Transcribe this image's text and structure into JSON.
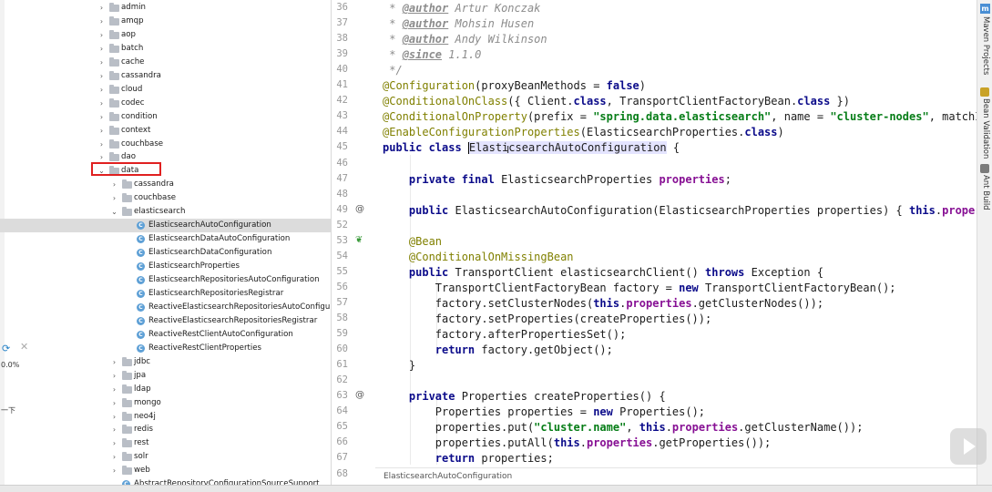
{
  "tree": {
    "items": [
      {
        "label": "admin",
        "type": "folder",
        "depth": 0,
        "expanded": false
      },
      {
        "label": "amqp",
        "type": "folder",
        "depth": 0,
        "expanded": false
      },
      {
        "label": "aop",
        "type": "folder",
        "depth": 0,
        "expanded": false
      },
      {
        "label": "batch",
        "type": "folder",
        "depth": 0,
        "expanded": false
      },
      {
        "label": "cache",
        "type": "folder",
        "depth": 0,
        "expanded": false
      },
      {
        "label": "cassandra",
        "type": "folder",
        "depth": 0,
        "expanded": false
      },
      {
        "label": "cloud",
        "type": "folder",
        "depth": 0,
        "expanded": false
      },
      {
        "label": "codec",
        "type": "folder",
        "depth": 0,
        "expanded": false
      },
      {
        "label": "condition",
        "type": "folder",
        "depth": 0,
        "expanded": false
      },
      {
        "label": "context",
        "type": "folder",
        "depth": 0,
        "expanded": false
      },
      {
        "label": "couchbase",
        "type": "folder",
        "depth": 0,
        "expanded": false
      },
      {
        "label": "dao",
        "type": "folder",
        "depth": 0,
        "expanded": false
      },
      {
        "label": "data",
        "type": "folder",
        "depth": 0,
        "expanded": true
      },
      {
        "label": "cassandra",
        "type": "folder",
        "depth": 1,
        "expanded": false
      },
      {
        "label": "couchbase",
        "type": "folder",
        "depth": 1,
        "expanded": false
      },
      {
        "label": "elasticsearch",
        "type": "folder",
        "depth": 1,
        "expanded": true
      },
      {
        "label": "ElasticsearchAutoConfiguration",
        "type": "class",
        "depth": 2,
        "selected": true
      },
      {
        "label": "ElasticsearchDataAutoConfiguration",
        "type": "class",
        "depth": 2
      },
      {
        "label": "ElasticsearchDataConfiguration",
        "type": "class",
        "depth": 2
      },
      {
        "label": "ElasticsearchProperties",
        "type": "class",
        "depth": 2
      },
      {
        "label": "ElasticsearchRepositoriesAutoConfiguration",
        "type": "class",
        "depth": 2
      },
      {
        "label": "ElasticsearchRepositoriesRegistrar",
        "type": "class",
        "depth": 2
      },
      {
        "label": "ReactiveElasticsearchRepositoriesAutoConfigurat",
        "type": "class",
        "depth": 2
      },
      {
        "label": "ReactiveElasticsearchRepositoriesRegistrar",
        "type": "class",
        "depth": 2
      },
      {
        "label": "ReactiveRestClientAutoConfiguration",
        "type": "class",
        "depth": 2
      },
      {
        "label": "ReactiveRestClientProperties",
        "type": "class",
        "depth": 2
      },
      {
        "label": "jdbc",
        "type": "folder",
        "depth": 1,
        "expanded": false
      },
      {
        "label": "jpa",
        "type": "folder",
        "depth": 1,
        "expanded": false
      },
      {
        "label": "ldap",
        "type": "folder",
        "depth": 1,
        "expanded": false
      },
      {
        "label": "mongo",
        "type": "folder",
        "depth": 1,
        "expanded": false
      },
      {
        "label": "neo4j",
        "type": "folder",
        "depth": 1,
        "expanded": false
      },
      {
        "label": "redis",
        "type": "folder",
        "depth": 1,
        "expanded": false
      },
      {
        "label": "rest",
        "type": "folder",
        "depth": 1,
        "expanded": false
      },
      {
        "label": "solr",
        "type": "folder",
        "depth": 1,
        "expanded": false
      },
      {
        "label": "web",
        "type": "folder",
        "depth": 1,
        "expanded": false
      },
      {
        "label": "AbstractRepositoryConfigurationSourceSupport",
        "type": "class",
        "depth": 1
      }
    ]
  },
  "overlay": {
    "percent": "0.0%",
    "chinese": "一下"
  },
  "editor": {
    "line_numbers": [
      "36",
      "37",
      "38",
      "39",
      "40",
      "41",
      "42",
      "43",
      "44",
      "45",
      "46",
      "47",
      "48",
      "49",
      "52",
      "53",
      "54",
      "55",
      "56",
      "57",
      "58",
      "59",
      "60",
      "61",
      "62",
      "63",
      "64",
      "65",
      "66",
      "67",
      "68"
    ],
    "lines": [
      [
        {
          "t": " * ",
          "c": "c"
        },
        {
          "t": "@author",
          "c": "cd"
        },
        {
          "t": " Artur Konczak",
          "c": "c"
        }
      ],
      [
        {
          "t": " * ",
          "c": "c"
        },
        {
          "t": "@author",
          "c": "cd"
        },
        {
          "t": " Mohsin Husen",
          "c": "c"
        }
      ],
      [
        {
          "t": " * ",
          "c": "c"
        },
        {
          "t": "@author",
          "c": "cd"
        },
        {
          "t": " Andy Wilkinson",
          "c": "c"
        }
      ],
      [
        {
          "t": " * ",
          "c": "c"
        },
        {
          "t": "@since",
          "c": "cd"
        },
        {
          "t": " 1.1.0",
          "c": "c"
        }
      ],
      [
        {
          "t": " */",
          "c": "c"
        }
      ],
      [
        {
          "t": "@Configuration",
          "c": "a"
        },
        {
          "t": "(proxyBeanMethods = ",
          "c": ""
        },
        {
          "t": "false",
          "c": "k"
        },
        {
          "t": ")",
          "c": ""
        }
      ],
      [
        {
          "t": "@ConditionalOnClass",
          "c": "a"
        },
        {
          "t": "({ Client.",
          "c": ""
        },
        {
          "t": "class",
          "c": "k"
        },
        {
          "t": ", TransportClientFactoryBean.",
          "c": ""
        },
        {
          "t": "class",
          "c": "k"
        },
        {
          "t": " })",
          "c": ""
        }
      ],
      [
        {
          "t": "@ConditionalOnProperty",
          "c": "a"
        },
        {
          "t": "(prefix = ",
          "c": ""
        },
        {
          "t": "\"spring.data.elasticsearch\"",
          "c": "s"
        },
        {
          "t": ", name = ",
          "c": ""
        },
        {
          "t": "\"cluster-nodes\"",
          "c": "s"
        },
        {
          "t": ", matchI",
          "c": ""
        }
      ],
      [
        {
          "t": "@EnableConfigurationProperties",
          "c": "a"
        },
        {
          "t": "(ElasticsearchProperties.",
          "c": ""
        },
        {
          "t": "class",
          "c": "k"
        },
        {
          "t": ")",
          "c": ""
        }
      ],
      [
        {
          "t": "public class ",
          "c": "k"
        },
        {
          "t": "|",
          "c": "caret"
        },
        {
          "t": "ElasticsearchAutoConfiguration",
          "c": "hl"
        },
        {
          "t": " {",
          "c": ""
        }
      ],
      [],
      [
        {
          "t": "    ",
          "c": ""
        },
        {
          "t": "private final ",
          "c": "k"
        },
        {
          "t": "ElasticsearchProperties ",
          "c": ""
        },
        {
          "t": "properties",
          "c": "f"
        },
        {
          "t": ";",
          "c": ""
        }
      ],
      [],
      [
        {
          "t": "    ",
          "c": ""
        },
        {
          "t": "public ",
          "c": "k"
        },
        {
          "t": "ElasticsearchAutoConfiguration(ElasticsearchProperties properties) { ",
          "c": ""
        },
        {
          "t": "this",
          "c": "k"
        },
        {
          "t": ".",
          "c": ""
        },
        {
          "t": "proper",
          "c": "f"
        }
      ],
      [],
      [
        {
          "t": "    ",
          "c": ""
        },
        {
          "t": "@Bean",
          "c": "a"
        }
      ],
      [
        {
          "t": "    ",
          "c": ""
        },
        {
          "t": "@ConditionalOnMissingBean",
          "c": "a"
        }
      ],
      [
        {
          "t": "    ",
          "c": ""
        },
        {
          "t": "public ",
          "c": "k"
        },
        {
          "t": "TransportClient elasticsearchClient() ",
          "c": ""
        },
        {
          "t": "throws ",
          "c": "k"
        },
        {
          "t": "Exception {",
          "c": ""
        }
      ],
      [
        {
          "t": "        TransportClientFactoryBean factory = ",
          "c": ""
        },
        {
          "t": "new ",
          "c": "k"
        },
        {
          "t": "TransportClientFactoryBean();",
          "c": ""
        }
      ],
      [
        {
          "t": "        factory.setClusterNodes(",
          "c": ""
        },
        {
          "t": "this",
          "c": "k"
        },
        {
          "t": ".",
          "c": ""
        },
        {
          "t": "properties",
          "c": "f"
        },
        {
          "t": ".getClusterNodes());",
          "c": ""
        }
      ],
      [
        {
          "t": "        factory.setProperties(createProperties());",
          "c": ""
        }
      ],
      [
        {
          "t": "        factory.afterPropertiesSet();",
          "c": ""
        }
      ],
      [
        {
          "t": "        ",
          "c": ""
        },
        {
          "t": "return ",
          "c": "k"
        },
        {
          "t": "factory.getObject();",
          "c": ""
        }
      ],
      [
        {
          "t": "    }",
          "c": ""
        }
      ],
      [],
      [
        {
          "t": "    ",
          "c": ""
        },
        {
          "t": "private ",
          "c": "k"
        },
        {
          "t": "Properties createProperties() {",
          "c": ""
        }
      ],
      [
        {
          "t": "        Properties properties = ",
          "c": ""
        },
        {
          "t": "new ",
          "c": "k"
        },
        {
          "t": "Properties();",
          "c": ""
        }
      ],
      [
        {
          "t": "        properties.put(",
          "c": ""
        },
        {
          "t": "\"cluster.name\"",
          "c": "s"
        },
        {
          "t": ", ",
          "c": ""
        },
        {
          "t": "this",
          "c": "k"
        },
        {
          "t": ".",
          "c": ""
        },
        {
          "t": "properties",
          "c": "f"
        },
        {
          "t": ".getClusterName());",
          "c": ""
        }
      ],
      [
        {
          "t": "        properties.putAll(",
          "c": ""
        },
        {
          "t": "this",
          "c": "k"
        },
        {
          "t": ".",
          "c": ""
        },
        {
          "t": "properties",
          "c": "f"
        },
        {
          "t": ".getProperties());",
          "c": ""
        }
      ],
      [
        {
          "t": "        ",
          "c": ""
        },
        {
          "t": "return ",
          "c": "k"
        },
        {
          "t": "properties;",
          "c": ""
        }
      ],
      [
        {
          "t": "    }",
          "c": ""
        }
      ]
    ],
    "gutter_icons": [
      {
        "line": "49",
        "icon": "@"
      },
      {
        "line": "53",
        "icon": "bean"
      },
      {
        "line": "63",
        "icon": "@"
      }
    ]
  },
  "breadcrumb": "ElasticsearchAutoConfiguration",
  "right_tabs": [
    "Maven Projects",
    "Bean Validation",
    "Ant Build"
  ],
  "colors": {
    "keyword": "#0b0b8a",
    "annotation": "#808000",
    "string": "#067d17",
    "field": "#871094",
    "comment": "#8c8c8c",
    "selection": "#dcdcdc",
    "highlight_box": "#e02020"
  }
}
